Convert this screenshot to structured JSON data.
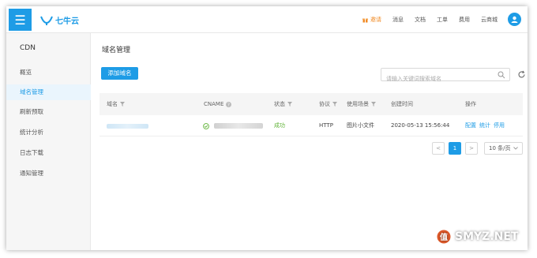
{
  "topbar": {
    "brand": "七牛云",
    "nav": [
      {
        "label": "邀请",
        "hot": true
      },
      {
        "label": "消息"
      },
      {
        "label": "文档"
      },
      {
        "label": "工单"
      },
      {
        "label": "费用"
      },
      {
        "label": "云商城"
      }
    ]
  },
  "sidebar": {
    "title": "CDN",
    "items": [
      {
        "label": "概览"
      },
      {
        "label": "域名管理",
        "active": true
      },
      {
        "label": "刷新预取"
      },
      {
        "label": "统计分析"
      },
      {
        "label": "日志下载"
      },
      {
        "label": "通知管理"
      }
    ]
  },
  "main": {
    "title": "域名管理",
    "add_button": "添加域名",
    "search_placeholder": "请输入关键词搜索域名"
  },
  "table": {
    "headers": {
      "domain": "域名",
      "cname": "CNAME",
      "status": "状态",
      "protocol": "协议",
      "scene": "使用场景",
      "created": "创建时间",
      "actions": "操作"
    },
    "rows": [
      {
        "status": "成功",
        "protocol": "HTTP",
        "scene": "图片小文件",
        "created": "2020-05-13 15:56:44",
        "actions": [
          "配置",
          "统计",
          "停用"
        ]
      }
    ]
  },
  "pagination": {
    "prev": "<",
    "current": "1",
    "next": ">",
    "page_size": "10 条/页"
  },
  "watermark": "SMYZ.NET",
  "colors": {
    "accent": "#1e9ce6",
    "success": "#5fb336",
    "hot": "#f08a24"
  }
}
